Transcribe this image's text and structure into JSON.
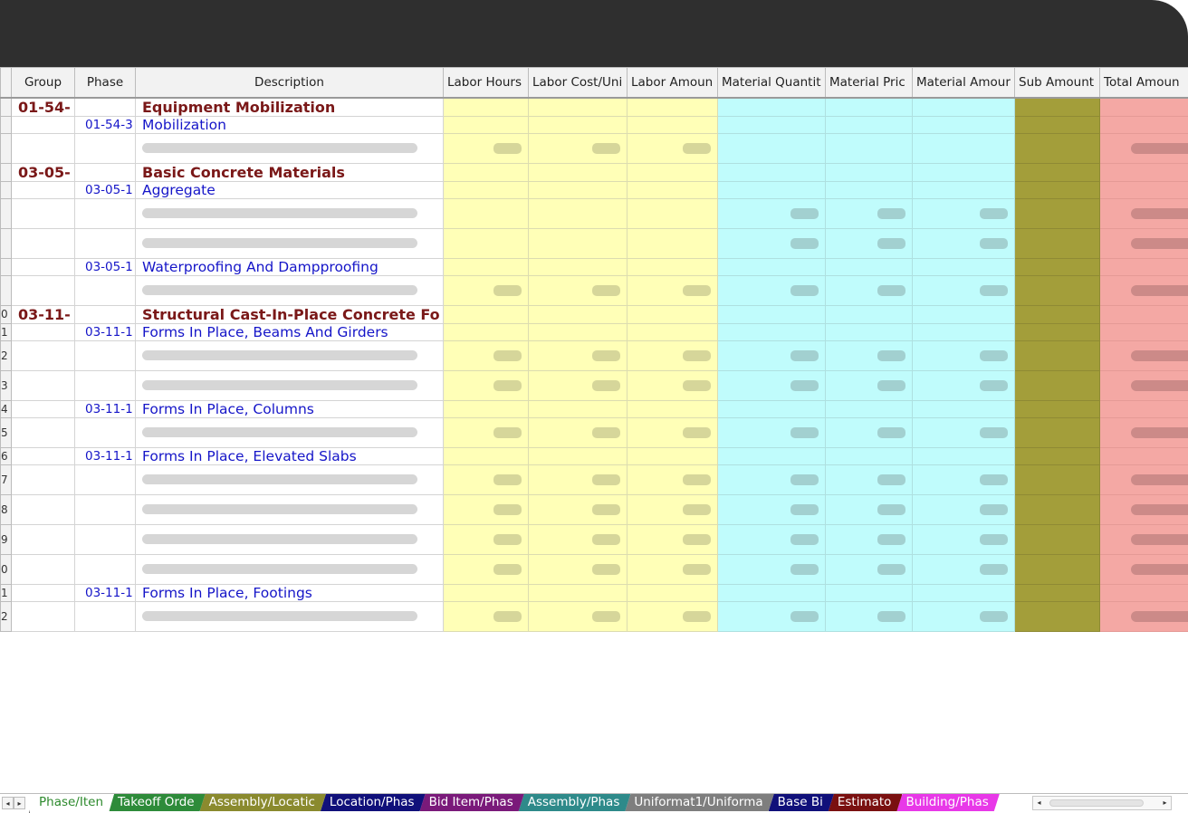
{
  "columns": {
    "group": "Group",
    "phase": "Phase",
    "description": "Description",
    "labor_hours": "Labor Hours",
    "labor_cost_unit": "Labor Cost/Uni",
    "labor_amount": "Labor Amoun",
    "material_quantity": "Material Quantit",
    "material_price": "Material Pric",
    "material_amount": "Material Amour",
    "sub_amount": "Sub Amount",
    "total_amount": "Total Amoun"
  },
  "rows": [
    {
      "type": "group",
      "rownum": "",
      "group": "01-54-",
      "description": "Equipment Mobilization"
    },
    {
      "type": "phase",
      "rownum": "",
      "phase": "01-54-3",
      "description": "Mobilization"
    },
    {
      "type": "item",
      "rownum": "",
      "labor": true,
      "material": false
    },
    {
      "type": "group",
      "rownum": "",
      "group": "03-05-",
      "description": "Basic Concrete Materials"
    },
    {
      "type": "phase",
      "rownum": "",
      "phase": "03-05-1",
      "description": "Aggregate"
    },
    {
      "type": "item",
      "rownum": "",
      "labor": false,
      "material": true
    },
    {
      "type": "item",
      "rownum": "",
      "labor": false,
      "material": true
    },
    {
      "type": "phase",
      "rownum": "",
      "phase": "03-05-1",
      "description": "Waterproofing And Dampproofing"
    },
    {
      "type": "item",
      "rownum": "",
      "labor": true,
      "material": true
    },
    {
      "type": "group",
      "rownum": "0",
      "group": "03-11-",
      "description": "Structural Cast-In-Place Concrete Fo"
    },
    {
      "type": "phase",
      "rownum": "1",
      "phase": "03-11-1",
      "description": "Forms In Place, Beams And Girders"
    },
    {
      "type": "item",
      "rownum": "2",
      "labor": true,
      "material": true
    },
    {
      "type": "item",
      "rownum": "3",
      "labor": true,
      "material": true
    },
    {
      "type": "phase",
      "rownum": "4",
      "phase": "03-11-1",
      "description": "Forms In Place, Columns"
    },
    {
      "type": "item",
      "rownum": "5",
      "labor": true,
      "material": true
    },
    {
      "type": "phase",
      "rownum": "6",
      "phase": "03-11-1",
      "description": "Forms In Place, Elevated Slabs"
    },
    {
      "type": "item",
      "rownum": "7",
      "labor": true,
      "material": true
    },
    {
      "type": "item",
      "rownum": "8",
      "labor": true,
      "material": true
    },
    {
      "type": "item",
      "rownum": "9",
      "labor": true,
      "material": true
    },
    {
      "type": "item",
      "rownum": "0",
      "labor": true,
      "material": true
    },
    {
      "type": "phase",
      "rownum": "1",
      "phase": "03-11-1",
      "description": "Forms In Place, Footings"
    },
    {
      "type": "item",
      "rownum": "2",
      "labor": true,
      "material": true
    }
  ],
  "sheet_tabs": [
    {
      "label": "Phase/Iten",
      "bg": "#ffffff",
      "fg": "#2d8a2d",
      "active": true
    },
    {
      "label": "Takeoff Orde",
      "bg": "#2e8b3a",
      "fg": "#ffffff"
    },
    {
      "label": "Assembly/Locatic",
      "bg": "#8a8a2e",
      "fg": "#ffffff"
    },
    {
      "label": "Location/Phas",
      "bg": "#10107a",
      "fg": "#ffffff"
    },
    {
      "label": "Bid Item/Phas",
      "bg": "#7a1a7a",
      "fg": "#ffffff"
    },
    {
      "label": "Assembly/Phas",
      "bg": "#2e8a8a",
      "fg": "#ffffff"
    },
    {
      "label": "Uniformat1/Uniforma",
      "bg": "#7e7e7e",
      "fg": "#ffffff"
    },
    {
      "label": "Base Bi",
      "bg": "#10107a",
      "fg": "#ffffff"
    },
    {
      "label": "Estimato",
      "bg": "#7a1010",
      "fg": "#ffffff"
    },
    {
      "label": "Building/Phas",
      "bg": "#e838e8",
      "fg": "#ffffff"
    }
  ],
  "icons": {
    "tab_prev": "◂",
    "tab_next": "▸",
    "scroll_left": "◂",
    "scroll_right": "▸"
  }
}
